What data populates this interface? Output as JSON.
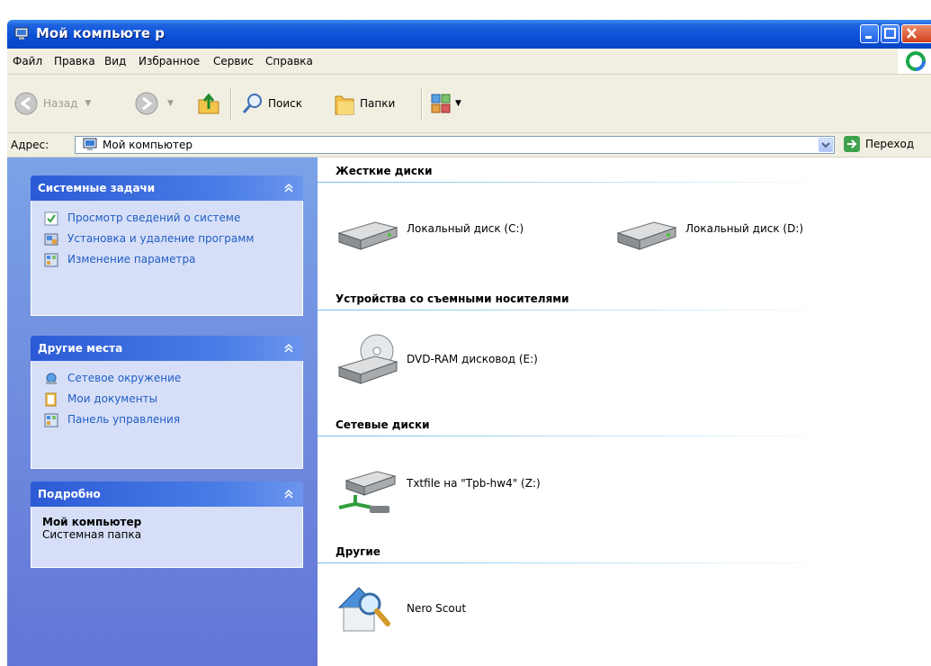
{
  "window": {
    "title": "Мой компьюте р"
  },
  "menu": {
    "items": [
      {
        "label": "Файл"
      },
      {
        "label": "Правка"
      },
      {
        "label": "Вид"
      },
      {
        "label": "Избранное"
      },
      {
        "label": "Сервис"
      },
      {
        "label": "Справка"
      }
    ]
  },
  "toolbar": {
    "back_label": "Назад",
    "search_label": "Поиск",
    "folders_label": "Папки"
  },
  "address": {
    "label": "Адрес:",
    "value": "Мой компьютер",
    "go_label": "Переход"
  },
  "sidebar": {
    "system_tasks": {
      "title": "Системные задачи",
      "items": [
        {
          "label": "Просмотр сведений о системе",
          "icon": "system-info-icon"
        },
        {
          "label": "Установка и удаление программ",
          "icon": "add-remove-programs-icon"
        },
        {
          "label": "Изменение параметра",
          "icon": "control-panel-icon"
        }
      ]
    },
    "other_places": {
      "title": "Другие места",
      "items": [
        {
          "label": "Сетевое окружение",
          "icon": "network-places-icon"
        },
        {
          "label": "Мои документы",
          "icon": "my-documents-icon"
        },
        {
          "label": "Панель управления",
          "icon": "control-panel-icon"
        }
      ]
    },
    "details": {
      "title": "Подробно",
      "name": "Мой компьютер",
      "type": "Системная папка"
    }
  },
  "content": {
    "hard_drives": {
      "title": "Жесткие диски",
      "items": [
        {
          "label": "Локальный диск (C:)",
          "icon": "hard-drive-icon"
        },
        {
          "label": "Локальный диск (D:)",
          "icon": "hard-drive-icon"
        }
      ]
    },
    "removable": {
      "title": "Устройства со съемными носителями",
      "items": [
        {
          "label": "DVD-RAM дисковод (E:)",
          "icon": "dvd-drive-icon"
        }
      ]
    },
    "network": {
      "title": "Сетевые диски",
      "items": [
        {
          "label": "Txtfile на \"Tpb-hw4\" (Z:)",
          "icon": "network-drive-icon"
        }
      ]
    },
    "other": {
      "title": "Другие",
      "items": [
        {
          "label": "Nero Scout",
          "icon": "nero-scout-icon"
        }
      ]
    }
  },
  "colors": {
    "titlebar": "#0a4fd6",
    "sidebar_bg": "#7ba2e7",
    "task_link": "#215dc6",
    "section_line": "#70bfea"
  }
}
